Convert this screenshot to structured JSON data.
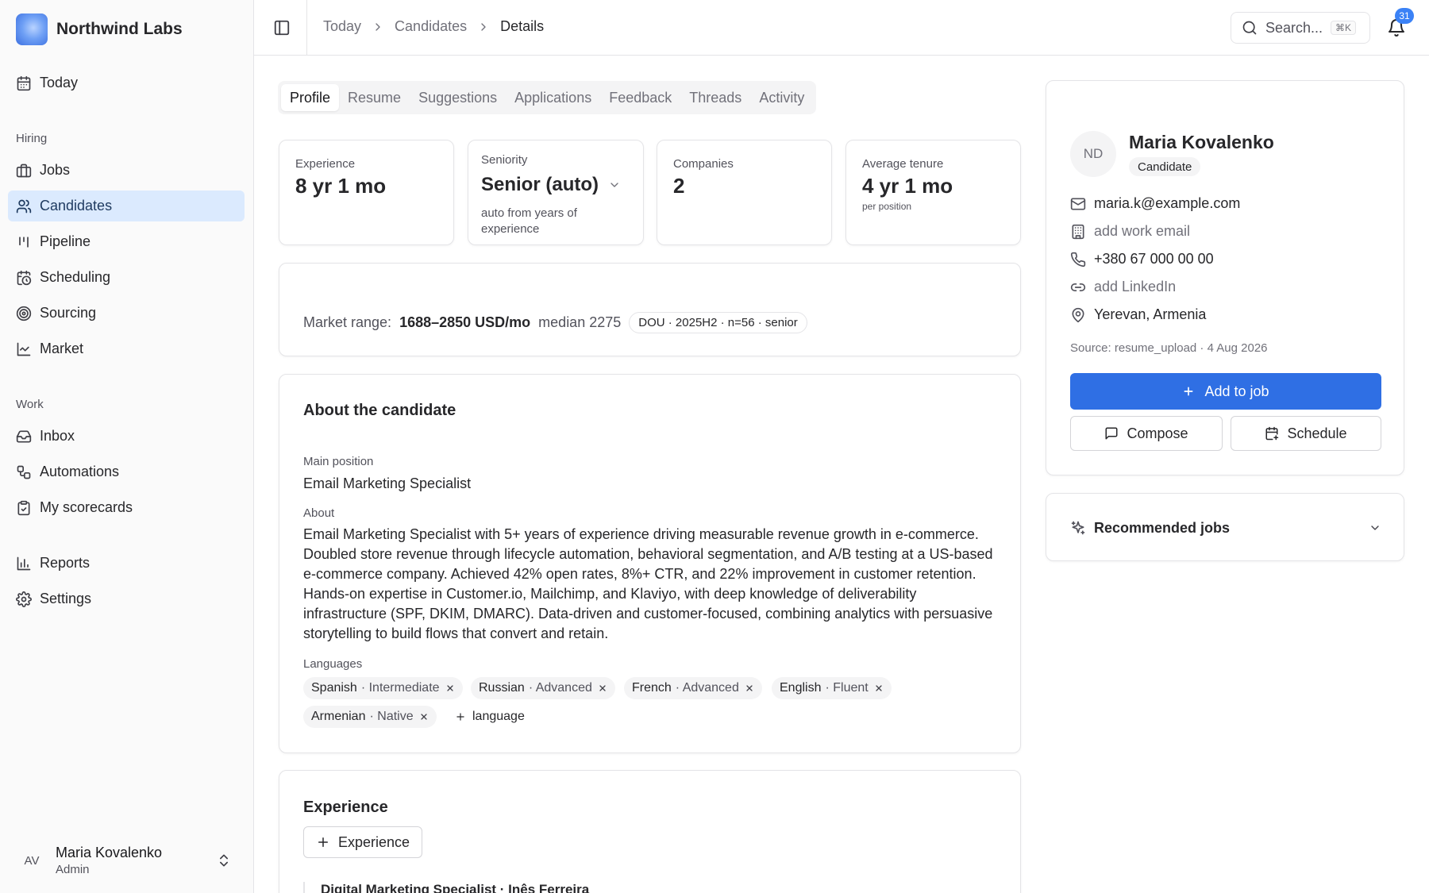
{
  "app": {
    "name": "Northwind Labs",
    "colors": {
      "accent": "#2f6fe4",
      "active_nav_bg": "#dbeafe",
      "badge": "#3b82f6"
    }
  },
  "sidebar": {
    "today_label": "Today",
    "sections": {
      "hiring": "Hiring",
      "work": "Work"
    },
    "items": [
      {
        "label": "Jobs",
        "icon": "briefcase-icon"
      },
      {
        "label": "Candidates",
        "icon": "users-icon",
        "active": true
      },
      {
        "label": "Pipeline",
        "icon": "kanban-icon"
      },
      {
        "label": "Scheduling",
        "icon": "calendar-clock-icon"
      },
      {
        "label": "Sourcing",
        "icon": "radar-icon"
      },
      {
        "label": "Market",
        "icon": "line-chart-icon"
      },
      {
        "label": "Inbox",
        "icon": "inbox-icon"
      },
      {
        "label": "Automations",
        "icon": "workflow-icon"
      },
      {
        "label": "My scorecards",
        "icon": "clipboard-check-icon"
      },
      {
        "label": "Reports",
        "icon": "bar-chart-icon"
      },
      {
        "label": "Settings",
        "icon": "gear-icon"
      }
    ],
    "user": {
      "initials": "AV",
      "name": "Maria Kovalenko",
      "role": "Admin"
    }
  },
  "topbar": {
    "breadcrumbs": [
      "Today",
      "Candidates",
      "Details"
    ],
    "search_placeholder": "Search...",
    "search_shortcut": "⌘K",
    "notifications_count": "31"
  },
  "tabs": [
    "Profile",
    "Resume",
    "Suggestions",
    "Applications",
    "Feedback",
    "Threads",
    "Activity"
  ],
  "active_tab": "Profile",
  "stats": {
    "experience": {
      "label": "Experience",
      "value": "8 yr 1 mo"
    },
    "seniority": {
      "label": "Seniority",
      "value": "Senior (auto)",
      "note": "auto from years of experience"
    },
    "companies": {
      "label": "Companies",
      "value": "2"
    },
    "tenure": {
      "label": "Average tenure",
      "value": "4 yr 1 mo",
      "sub": "per position"
    }
  },
  "market": {
    "label": "Market range:",
    "range": "1688–2850 USD/mo",
    "median": "median 2275",
    "badge": "DOU · 2025H2 · n=56 · senior"
  },
  "about": {
    "title": "About the candidate",
    "main_position_label": "Main position",
    "main_position": "Email Marketing Specialist",
    "about_label": "About",
    "about_text": "Email Marketing Specialist with 5+ years of experience driving measurable revenue growth in e-commerce. Doubled store revenue through lifecycle automation, behavioral segmentation, and A/B testing at a US-based e-commerce company. Achieved 42% open rates, 8%+ CTR, and 22% improvement in customer retention. Hands-on expertise in Customer.io, Mailchimp, and Klaviyo, with deep knowledge of deliverability infrastructure (SPF, DKIM, DMARC). Data-driven and customer-focused, combining analytics with persuasive storytelling to build flows that convert and retain.",
    "languages_label": "Languages",
    "languages": [
      {
        "name": "Spanish",
        "level": "· Intermediate"
      },
      {
        "name": "Russian",
        "level": "· Advanced"
      },
      {
        "name": "French",
        "level": "· Advanced"
      },
      {
        "name": "English",
        "level": "· Fluent"
      },
      {
        "name": "Armenian",
        "level": "· Native"
      }
    ],
    "add_language_label": "language"
  },
  "experience": {
    "title": "Experience",
    "add_label": "Experience",
    "first_item": "Digital Marketing Specialist · Inês Ferreira"
  },
  "profile": {
    "initials": "ND",
    "name": "Maria Kovalenko",
    "badge": "Candidate",
    "email": "maria.k@example.com",
    "work_email": "add work email",
    "phone": "+380 67 000 00 00",
    "linkedin": "add LinkedIn",
    "location": "Yerevan, Armenia",
    "source": "Source: resume_upload · 4 Aug 2026",
    "add_to_job": "Add to job",
    "compose": "Compose",
    "schedule": "Schedule"
  },
  "recommended": {
    "title": "Recommended jobs"
  }
}
